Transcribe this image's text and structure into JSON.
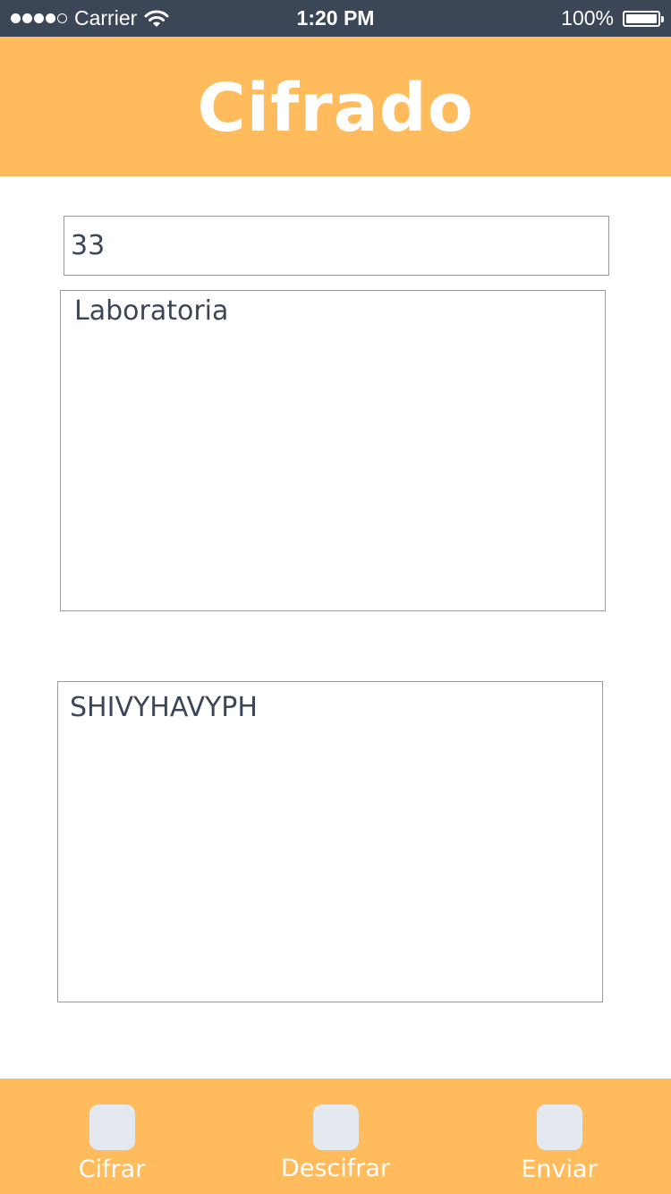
{
  "status_bar": {
    "carrier": "Carrier",
    "time": "1:20 PM",
    "battery": "100%",
    "signal_icon": "signal-dots-icon",
    "wifi_icon": "wifi-icon",
    "battery_icon": "battery-icon"
  },
  "header": {
    "title": "Cifrado",
    "background": "#ffbb5c"
  },
  "form": {
    "key_value": "33",
    "input_text": "Laboratoria",
    "output_text": "SHIVYHAVYPH"
  },
  "tab_bar": {
    "background": "#ffbb5c",
    "tabs": [
      {
        "label": "Cifrar",
        "icon": "cifrar-tab-icon"
      },
      {
        "label": "Descifrar",
        "icon": "descifrar-tab-icon"
      },
      {
        "label": "Enviar",
        "icon": "enviar-tab-icon"
      }
    ]
  },
  "colors": {
    "status_bar_bg": "#3b4657",
    "text": "#3b4657",
    "tab_icon": "#e4e8ef"
  }
}
